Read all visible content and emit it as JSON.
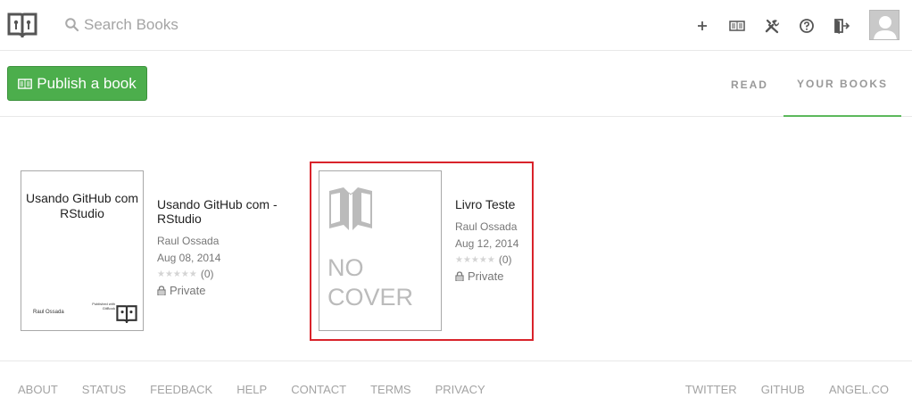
{
  "header": {
    "logo_icon": "gitbook-logo-icon",
    "search": {
      "placeholder": "Search Books",
      "icon": "search-icon"
    },
    "actions": [
      {
        "name": "add-button",
        "icon": "plus-icon"
      },
      {
        "name": "books-button",
        "icon": "book-icon"
      },
      {
        "name": "tools-button",
        "icon": "tools-icon"
      },
      {
        "name": "help-button",
        "icon": "help-icon"
      },
      {
        "name": "logout-button",
        "icon": "logout-icon"
      }
    ],
    "avatar_icon": "avatar-icon"
  },
  "subheader": {
    "publish_label": "Publish a book",
    "tabs": [
      {
        "label": "READ",
        "active": false
      },
      {
        "label": "YOUR BOOKS",
        "active": true
      }
    ],
    "accent": "#5cb85c"
  },
  "books": [
    {
      "cover_title": "Usando GitHub com RStudio",
      "cover_author": "Raul Ossada",
      "cover_publisher": "Published with GitBook",
      "title": "Usando GitHub com - RStudio",
      "author": "Raul Ossada",
      "date": "Aug 08, 2014",
      "rating_count": "(0)",
      "visibility": "Private"
    },
    {
      "cover_text": "NO COVER",
      "title": "Livro Teste",
      "author": "Raul Ossada",
      "date": "Aug 12, 2014",
      "rating_count": "(0)",
      "visibility": "Private",
      "highlight_color": "#d9232b"
    }
  ],
  "footer": {
    "left_links": [
      "ABOUT",
      "STATUS",
      "FEEDBACK",
      "HELP",
      "CONTACT",
      "TERMS",
      "PRIVACY"
    ],
    "right_links": [
      "TWITTER",
      "GITHUB",
      "ANGEL.CO"
    ]
  }
}
